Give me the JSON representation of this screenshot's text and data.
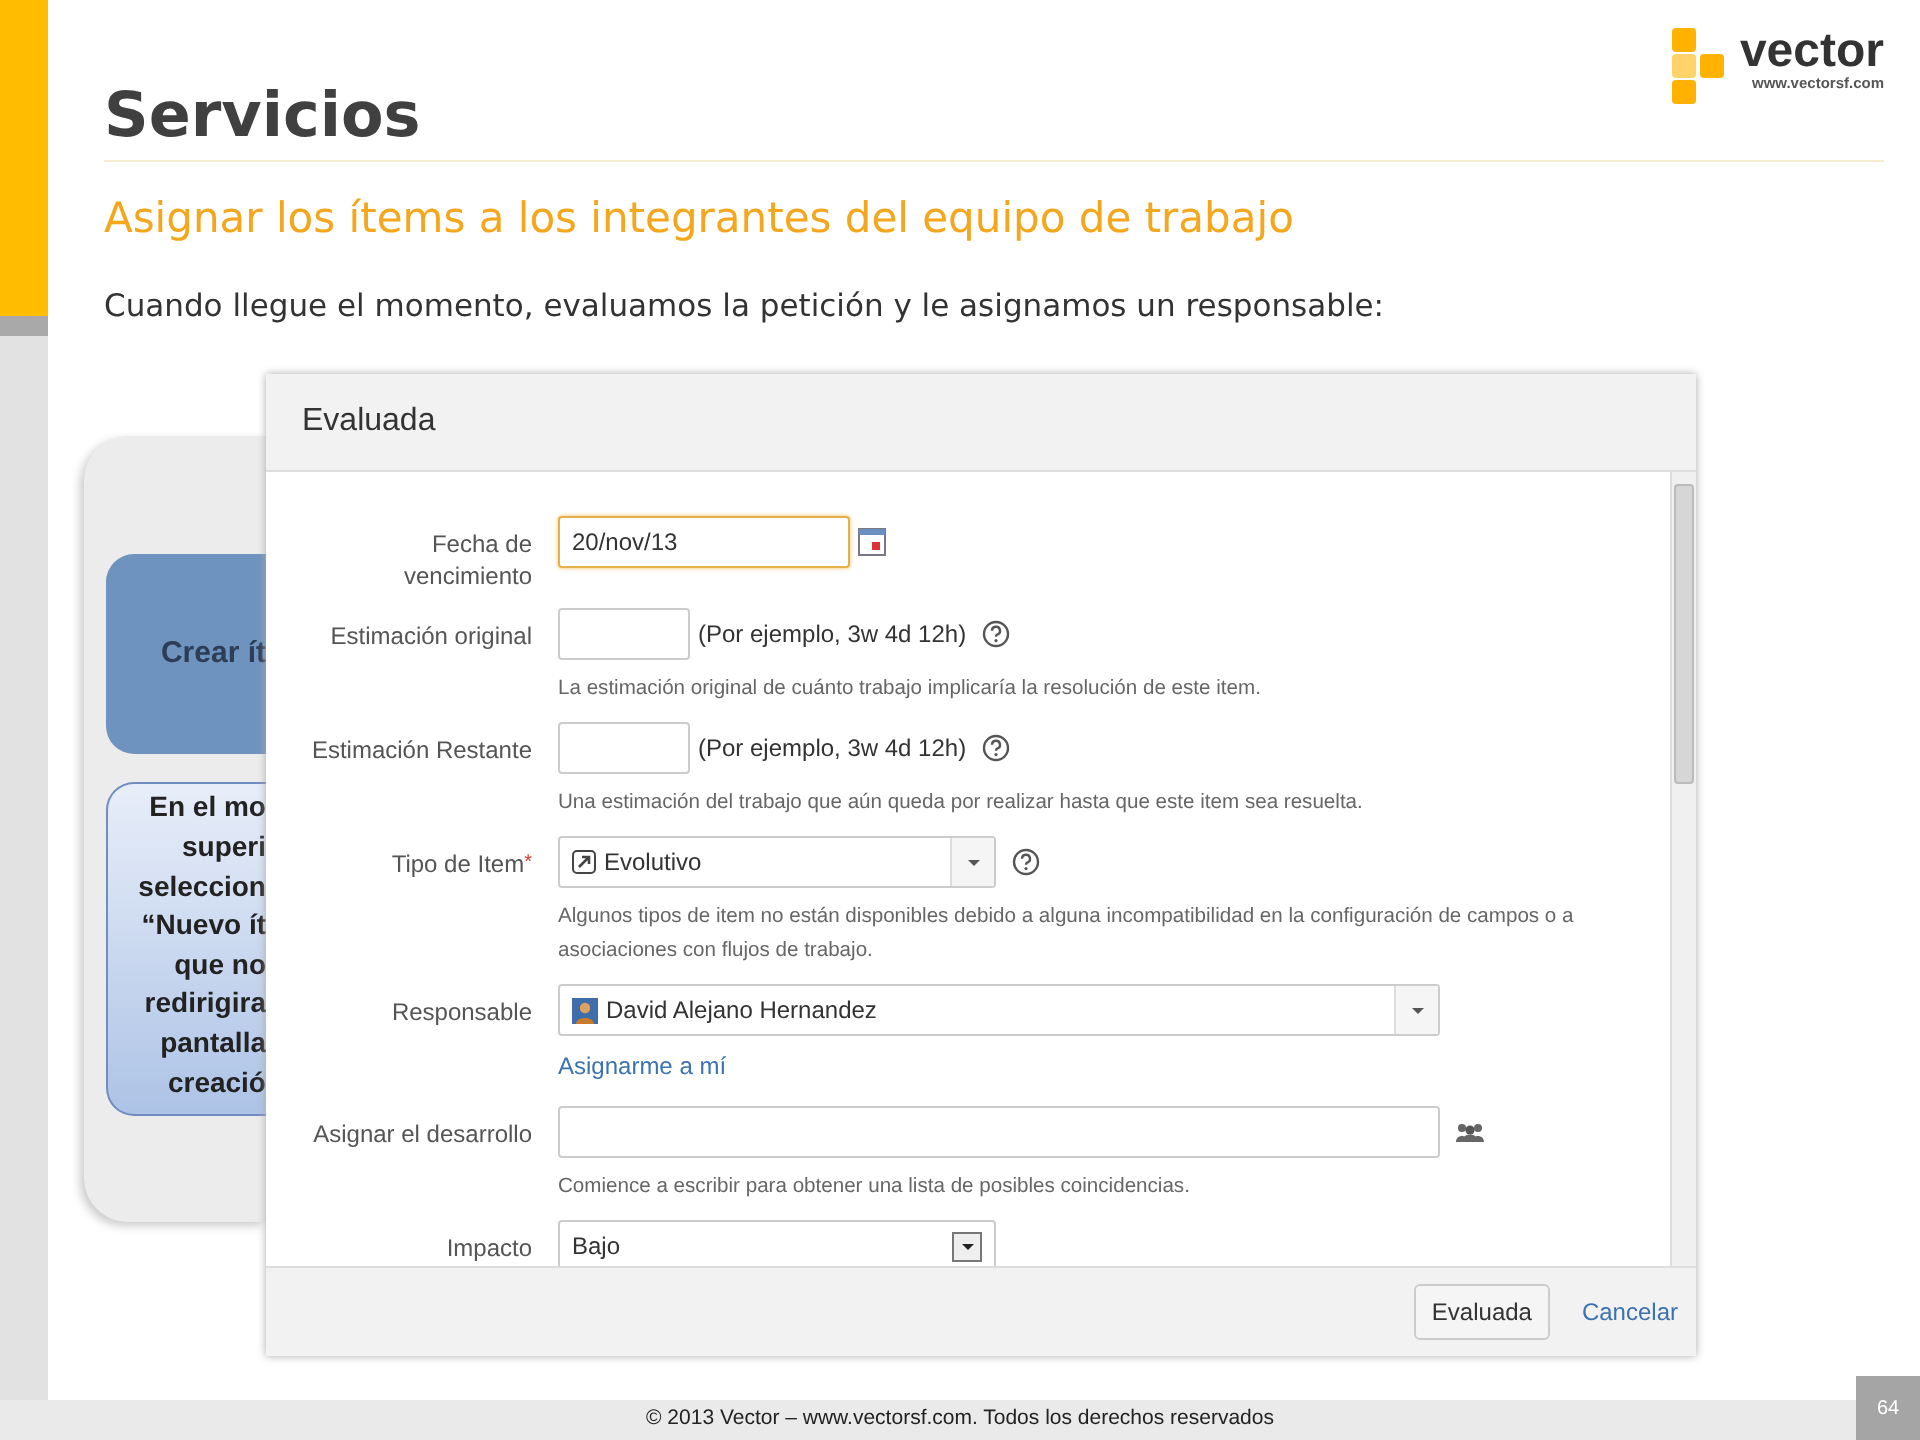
{
  "slide": {
    "title": "Servicios",
    "subtitle": "Asignar los ítems a los integrantes del equipo de trabajo",
    "intro": "Cuando llegue el momento, evaluamos la petición y le asignamos un responsable:",
    "logo": {
      "name": "vector",
      "url": "www.vectorsf.com"
    },
    "footer": "© 2013 Vector – www.vectorsf.com. Todos los derechos reservados",
    "page_number": "64"
  },
  "diagram": {
    "step": "Crear ít",
    "note_lines": [
      "En el mo",
      "superi",
      "seleccion",
      "“Nuevo ít",
      "que no",
      "redirigira",
      "pantalla",
      "creació"
    ]
  },
  "dialog": {
    "title": "Evaluada",
    "fields": [
      {
        "kind": "date",
        "label": "Fecha de vencimiento",
        "value": "20/nov/13",
        "focused": true
      },
      {
        "kind": "duration",
        "label": "Estimación original",
        "example": "(Por ejemplo, 3w 4d 12h)",
        "description": "La estimación original de cuánto trabajo implicaría la resolución de este item."
      },
      {
        "kind": "duration",
        "label": "Estimación Restante",
        "example": "(Por ejemplo, 3w 4d 12h)",
        "description": "Una estimación del trabajo que aún queda por realizar hasta que este item sea resuelta."
      },
      {
        "kind": "issuetype",
        "label": "Tipo de Item",
        "required_mark": "*",
        "value": "Evolutivo",
        "description": "Algunos tipos de item no están disponibles debido a alguna incompatibilidad en la configuración de campos o a asociaciones con flujos de trabajo."
      },
      {
        "kind": "user",
        "label": "Responsable",
        "value": "David Alejano Hernandez",
        "link": "Asignarme a mí"
      },
      {
        "kind": "users",
        "label": "Asignar el desarrollo",
        "description": "Comience a escribir para obtener una lista de posibles coincidencias."
      },
      {
        "kind": "select",
        "label": "Impacto",
        "value": "Bajo"
      }
    ],
    "buttons": [
      {
        "kind": "primary",
        "label": "Evaluada"
      },
      {
        "kind": "link",
        "label": "Cancelar"
      }
    ]
  }
}
